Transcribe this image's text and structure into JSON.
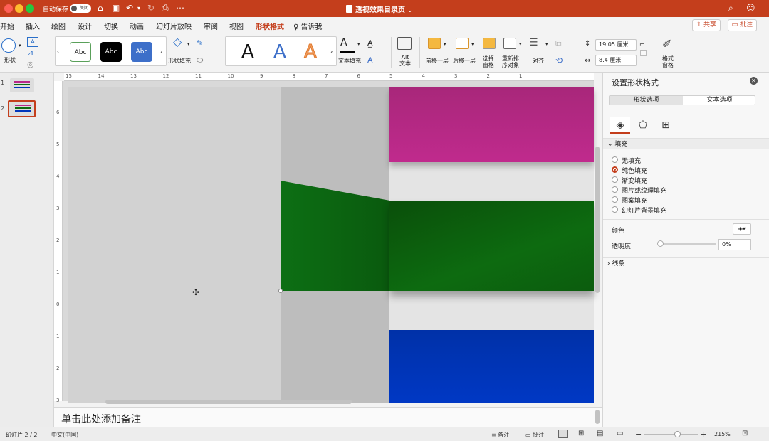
{
  "titlebar": {
    "autosave_label": "自动保存",
    "autosave_state": "关闭",
    "doc_title": "透视效果目录页",
    "icons": [
      "home-icon",
      "save-icon",
      "undo-icon",
      "redo-icon",
      "print-icon",
      "more-icon",
      "search-icon",
      "smiley-icon"
    ]
  },
  "tabs": [
    "开始",
    "插入",
    "绘图",
    "设计",
    "切换",
    "动画",
    "幻灯片放映",
    "审阅",
    "视图",
    "形状格式",
    "告诉我"
  ],
  "active_tab": "形状格式",
  "share_label": "共享",
  "comment_label": "批注",
  "ribbon": {
    "shape_label": "形状",
    "style_samples": [
      "Abc",
      "Abc",
      "Abc"
    ],
    "shape_fill_label": "形状填充",
    "wordart_samples": [
      "A",
      "A",
      "A"
    ],
    "text_fill_label": "文本填充",
    "alt_text_label": "Alt\n文本",
    "alt_line1": "Alt",
    "alt_line2": "文本",
    "bring_forward": "前移一层",
    "send_backward": "后移一层",
    "selection_pane_1": "选择",
    "selection_pane_2": "窗格",
    "reorder_1": "重新排",
    "reorder_2": "序对象",
    "align": "对齐",
    "height_value": "19.05 厘米",
    "width_value": "8.4 厘米",
    "format_pane_1": "格式",
    "format_pane_2": "窗格"
  },
  "slides": [
    {
      "number": "1"
    },
    {
      "number": "2"
    }
  ],
  "hruler": [
    "15",
    "14",
    "13",
    "12",
    "11",
    "10",
    "9",
    "8",
    "7",
    "6",
    "5",
    "4",
    "3",
    "2",
    "1"
  ],
  "vruler": [
    "6",
    "5",
    "4",
    "3",
    "2",
    "1",
    "0",
    "1",
    "2",
    "3"
  ],
  "notes_placeholder": "单击此处添加备注",
  "pane": {
    "title": "设置形状格式",
    "tab_shape": "形状选项",
    "tab_text": "文本选项",
    "fill_section": "填充",
    "fill_options": [
      "无填充",
      "纯色填充",
      "渐变填充",
      "图片或纹理填充",
      "图案填充",
      "幻灯片背景填充"
    ],
    "selected_fill": "纯色填充",
    "color_label": "颜色",
    "transparency_label": "透明度",
    "transparency_value": "0%",
    "line_section": "线条"
  },
  "status": {
    "slide_info": "幻灯片 2 / 2",
    "language": "中文(中国)",
    "notes_btn": "备注",
    "comments_btn": "批注",
    "zoom": "215%"
  },
  "colors": {
    "accent": "#c43e1c",
    "pink": "#b8288a",
    "green": "#0d6b10",
    "blue": "#0036bb"
  }
}
